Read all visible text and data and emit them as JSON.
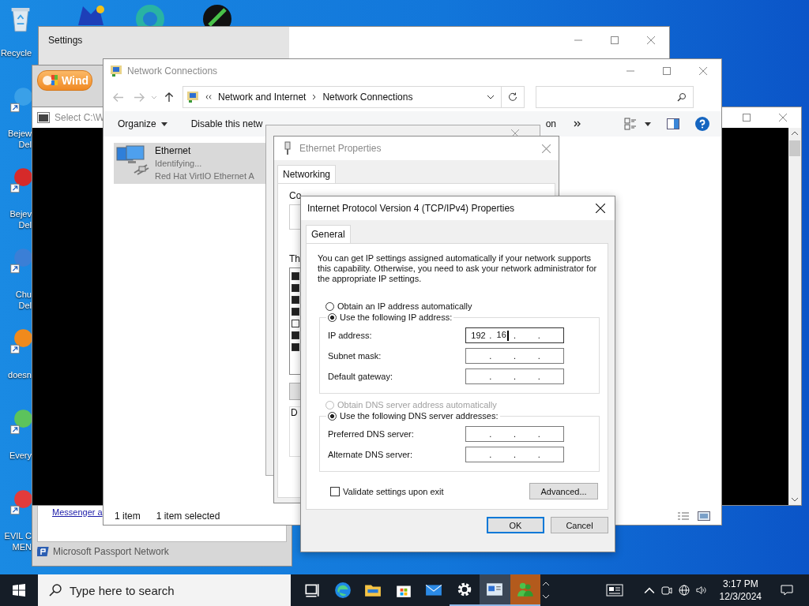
{
  "desktop_icons": [
    {
      "kind": "recycle-bin",
      "label_lines": [
        "Recycle"
      ]
    },
    {
      "kind": "shortcut",
      "label_lines": [
        "Bejew",
        "Del"
      ]
    },
    {
      "kind": "shortcut",
      "label_lines": [
        "Bejev",
        "Del"
      ]
    },
    {
      "kind": "shortcut",
      "label_lines": [
        "Chu",
        "Del"
      ]
    },
    {
      "kind": "shortcut",
      "label_lines": [
        "doesn"
      ]
    },
    {
      "kind": "shortcut",
      "label_lines": [
        "Every"
      ]
    },
    {
      "kind": "shortcut",
      "label_lines": [
        "EVIL C",
        "MEN"
      ]
    }
  ],
  "settings_window": {
    "title": "Settings"
  },
  "browser_window": {
    "button": "Wind",
    "link": "Messenger a",
    "status": "Microsoft Passport Network"
  },
  "console_window": {
    "title": "Select C:\\W"
  },
  "network_connections": {
    "title": "Network Connections",
    "breadcrumb": [
      "Network and Internet",
      "Network Connections"
    ],
    "toolbar": [
      "Organize",
      "Disable this netw",
      "on"
    ],
    "items": [
      {
        "name": "Ethernet",
        "status": "Identifying...",
        "device": "Red Hat VirtIO Ethernet A",
        "selected": true
      }
    ],
    "status_bar": [
      "1 item",
      "1 item selected"
    ]
  },
  "ethernet_properties": {
    "title": "Ethernet Properties",
    "tab": "Networking",
    "label_1": "Co",
    "label_2": "Th",
    "label_3": "D",
    "components": [
      {
        "checked": true
      },
      {
        "checked": true
      },
      {
        "checked": true
      },
      {
        "checked": true
      },
      {
        "checked": false
      },
      {
        "checked": true
      },
      {
        "checked": true
      }
    ]
  },
  "ipv4_dialog": {
    "title": "Internet Protocol Version 4 (TCP/IPv4) Properties",
    "tab": "General",
    "description": "You can get IP settings assigned automatically if your network supports this capability. Otherwise, you need to ask your network administrator for the appropriate IP settings.",
    "octet_separator": ".",
    "ip_mode": [
      {
        "label": "Obtain an IP address automatically",
        "selected": false,
        "disabled": false
      },
      {
        "label": "Use the following IP address:",
        "selected": true,
        "disabled": false
      }
    ],
    "ip_fields": [
      {
        "label": "IP address:",
        "octets": [
          "192",
          "16"
        ],
        "focused": true
      },
      {
        "label": "Subnet mask:",
        "focused": false
      },
      {
        "label": "Default gateway:",
        "focused": false
      }
    ],
    "dns_mode": [
      {
        "label": "Obtain DNS server address automatically",
        "selected": false,
        "disabled": true
      },
      {
        "label": "Use the following DNS server addresses:",
        "selected": true,
        "disabled": false
      }
    ],
    "dns_fields": [
      {
        "label": "Preferred DNS server:",
        "focused": false
      },
      {
        "label": "Alternate DNS server:",
        "focused": false
      }
    ],
    "validate": {
      "label": "Validate settings upon exit",
      "checked": false
    },
    "advanced_button": "Advanced...",
    "ok_button": "OK",
    "cancel_button": "Cancel"
  },
  "taskbar": {
    "search_placeholder": "Type here to search",
    "apps": [
      {
        "kind": "task-view",
        "running": false,
        "selected": false
      },
      {
        "kind": "browser",
        "running": false,
        "selected": false
      },
      {
        "kind": "folder",
        "running": false,
        "selected": false
      },
      {
        "kind": "store",
        "running": false,
        "selected": false
      },
      {
        "kind": "mail",
        "running": false,
        "selected": false
      },
      {
        "kind": "gear",
        "running": true,
        "selected": false
      },
      {
        "kind": "network",
        "running": true,
        "selected": true
      },
      {
        "kind": "people",
        "running": true,
        "selected": false
      }
    ],
    "time": "3:17 PM",
    "date": "12/3/2024"
  }
}
